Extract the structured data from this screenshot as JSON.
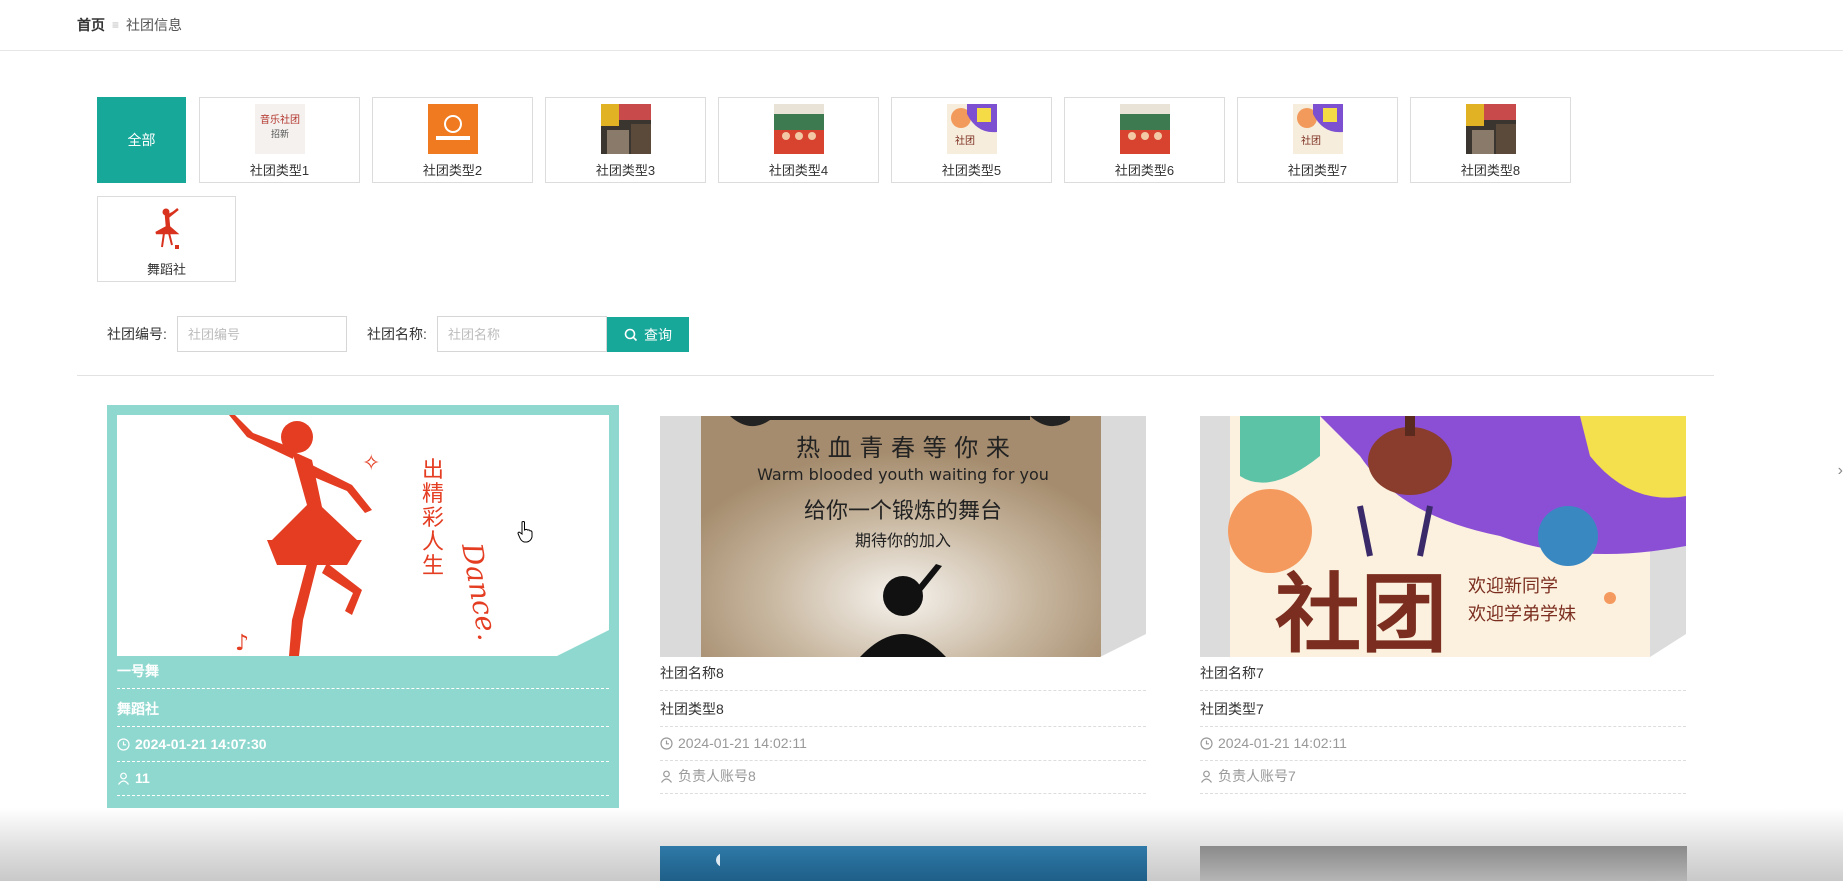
{
  "breadcrumb": {
    "home": "首页",
    "separator": "≡",
    "current": "社团信息"
  },
  "categories": {
    "all_label": "全部",
    "items": [
      {
        "label": "社团类型1",
        "thumb": "text-poster-icon"
      },
      {
        "label": "社团类型2",
        "thumb": "orange-logo-icon"
      },
      {
        "label": "社团类型3",
        "thumb": "collage-icon"
      },
      {
        "label": "社团类型4",
        "thumb": "group-photo-icon"
      },
      {
        "label": "社团类型5",
        "thumb": "colorful-poster-icon"
      },
      {
        "label": "社团类型6",
        "thumb": "group-photo-icon"
      },
      {
        "label": "社团类型7",
        "thumb": "colorful-poster-icon"
      },
      {
        "label": "社团类型8",
        "thumb": "collage-icon"
      },
      {
        "label": "舞蹈社",
        "thumb": "dancer-icon"
      }
    ]
  },
  "search": {
    "id_label": "社团编号:",
    "id_placeholder": "社团编号",
    "name_label": "社团名称:",
    "name_placeholder": "社团名称",
    "button_label": "查询"
  },
  "cards": [
    {
      "name": "一号舞",
      "type": "舞蹈社",
      "time": "2024-01-21 14:07:30",
      "owner": "11",
      "poster_text": [
        "出",
        "精",
        "彩",
        "人",
        "生"
      ]
    },
    {
      "name": "社团名称8",
      "type": "社团类型8",
      "time": "2024-01-21 14:02:11",
      "owner": "负责人账号8",
      "poster_text": [
        "热 血 青 春 等 你 来",
        "Warm blooded youth waiting for you",
        "给你一个锻炼的舞台",
        "期待你的加入"
      ]
    },
    {
      "name": "社团名称7",
      "type": "社团类型7",
      "time": "2024-01-21 14:02:11",
      "owner": "负责人账号7",
      "poster_text": [
        "社团",
        "欢迎新同学",
        "欢迎学弟学妹"
      ]
    }
  ],
  "colors": {
    "accent": "#17a89a",
    "active_card": "#8fd8cf",
    "poster_red": "#e43d22"
  }
}
